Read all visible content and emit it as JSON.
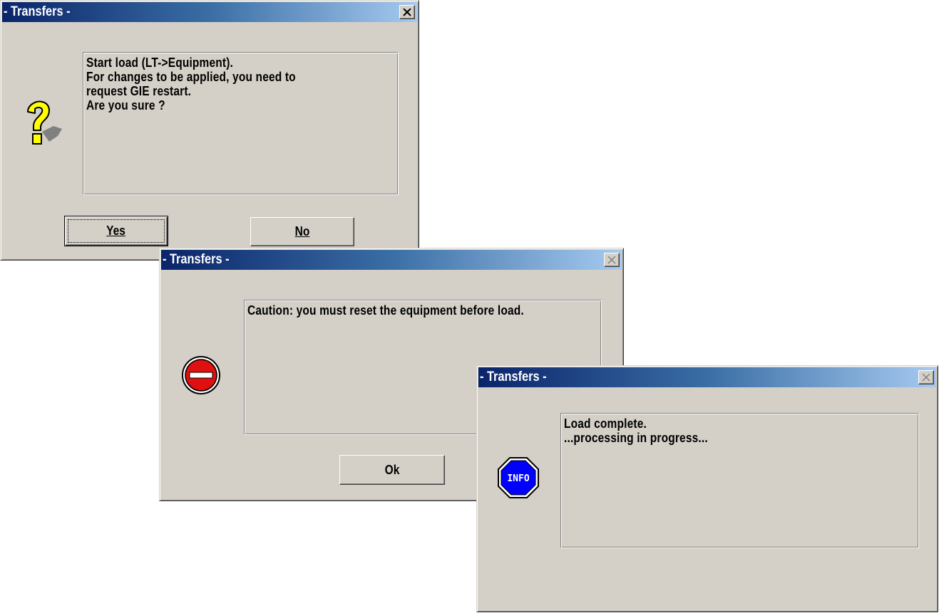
{
  "dialogs": {
    "confirm": {
      "title": "- Transfers -",
      "icon": "question-icon",
      "message_lines": [
        "Start load (LT->Equipment).",
        "For changes to be applied, you need to",
        "request GIE restart.",
        "Are you sure ?"
      ],
      "yes_label": "Yes",
      "no_label": "No"
    },
    "caution": {
      "title": "- Transfers -",
      "icon": "stop-icon",
      "message_lines": [
        "Caution: you must reset the equipment before load."
      ],
      "ok_label": "Ok"
    },
    "info": {
      "title": "- Transfers -",
      "icon": "info-icon",
      "icon_text": "INFO",
      "message_lines": [
        "Load complete.",
        "...processing in progress..."
      ]
    }
  },
  "colors": {
    "dialog_face": "#d4d0c8",
    "title_gradient_start": "#0a246a",
    "title_gradient_end": "#a6caf0",
    "stop_red": "#e01010",
    "info_blue": "#0000ff",
    "question_yellow": "#ffff00"
  }
}
